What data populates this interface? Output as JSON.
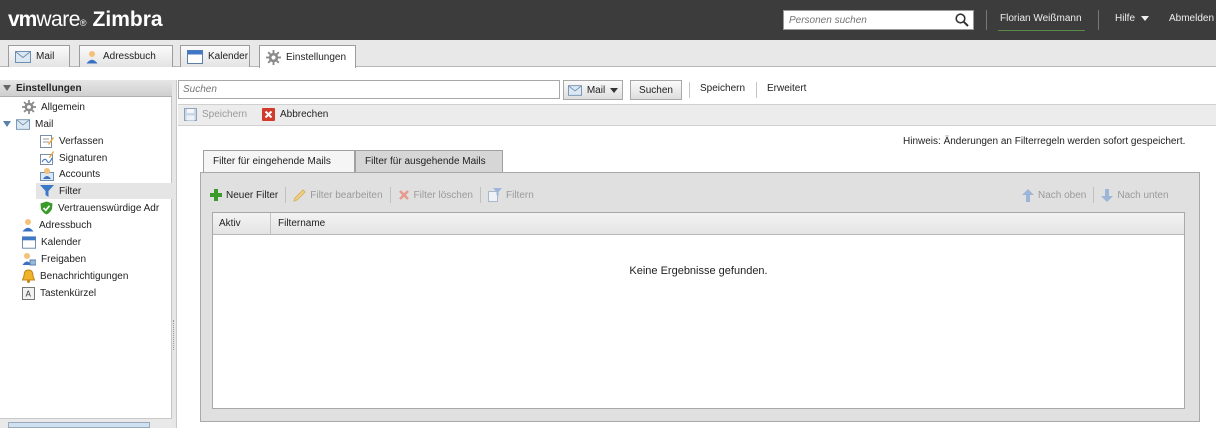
{
  "header": {
    "logo_vm": "vm",
    "logo_ware": "ware",
    "logo_product": "Zimbra",
    "search_placeholder": "Personen suchen",
    "user_name": "Florian Weißmann",
    "help_label": "Hilfe",
    "logout_label": "Abmelden"
  },
  "app_tabs": [
    {
      "label": "Mail",
      "icon": "mail-icon"
    },
    {
      "label": "Adressbuch",
      "icon": "addressbook-icon"
    },
    {
      "label": "Kalender",
      "icon": "calendar-icon"
    },
    {
      "label": "Einstellungen",
      "icon": "gear-icon",
      "active": true
    }
  ],
  "sidebar": {
    "title": "Einstellungen",
    "items": [
      {
        "label": "Allgemein",
        "icon": "gear-icon"
      },
      {
        "label": "Mail",
        "icon": "mail-icon"
      },
      {
        "label": "Verfassen",
        "icon": "compose-icon"
      },
      {
        "label": "Signaturen",
        "icon": "signature-icon"
      },
      {
        "label": "Accounts",
        "icon": "accounts-icon"
      },
      {
        "label": "Filter",
        "icon": "filter-icon",
        "selected": true
      },
      {
        "label": "Vertrauenswürdige Adr",
        "icon": "shield-icon"
      },
      {
        "label": "Adressbuch",
        "icon": "addressbook-icon"
      },
      {
        "label": "Kalender",
        "icon": "calendar-icon"
      },
      {
        "label": "Freigaben",
        "icon": "sharing-icon"
      },
      {
        "label": "Benachrichtigungen",
        "icon": "bell-icon"
      },
      {
        "label": "Tastenkürzel",
        "icon": "keyboard-icon"
      }
    ]
  },
  "toolbar": {
    "search_placeholder": "Suchen",
    "scope_label": "Mail",
    "search_button": "Suchen",
    "save_search": "Speichern",
    "advanced": "Erweitert"
  },
  "subbar": {
    "save_label": "Speichern",
    "cancel_label": "Abbrechen"
  },
  "notice": "Hinweis: Änderungen an Filterregeln werden sofort gespeichert.",
  "filter_tabs": [
    {
      "label": "Filter für eingehende Mails",
      "active": true
    },
    {
      "label": "Filter für ausgehende Mails",
      "active": false
    }
  ],
  "filter_toolbar": {
    "new": "Neuer Filter",
    "edit": "Filter bearbeiten",
    "delete": "Filter löschen",
    "run": "Filtern",
    "up": "Nach oben",
    "down": "Nach unten"
  },
  "table": {
    "columns": [
      "Aktiv",
      "Filtername"
    ],
    "empty_message": "Keine Ergebnisse gefunden."
  },
  "colors": {
    "header_bg": "#3c3c3c",
    "accent_green": "#3a9a2a",
    "cancel_red": "#d23a2a"
  }
}
